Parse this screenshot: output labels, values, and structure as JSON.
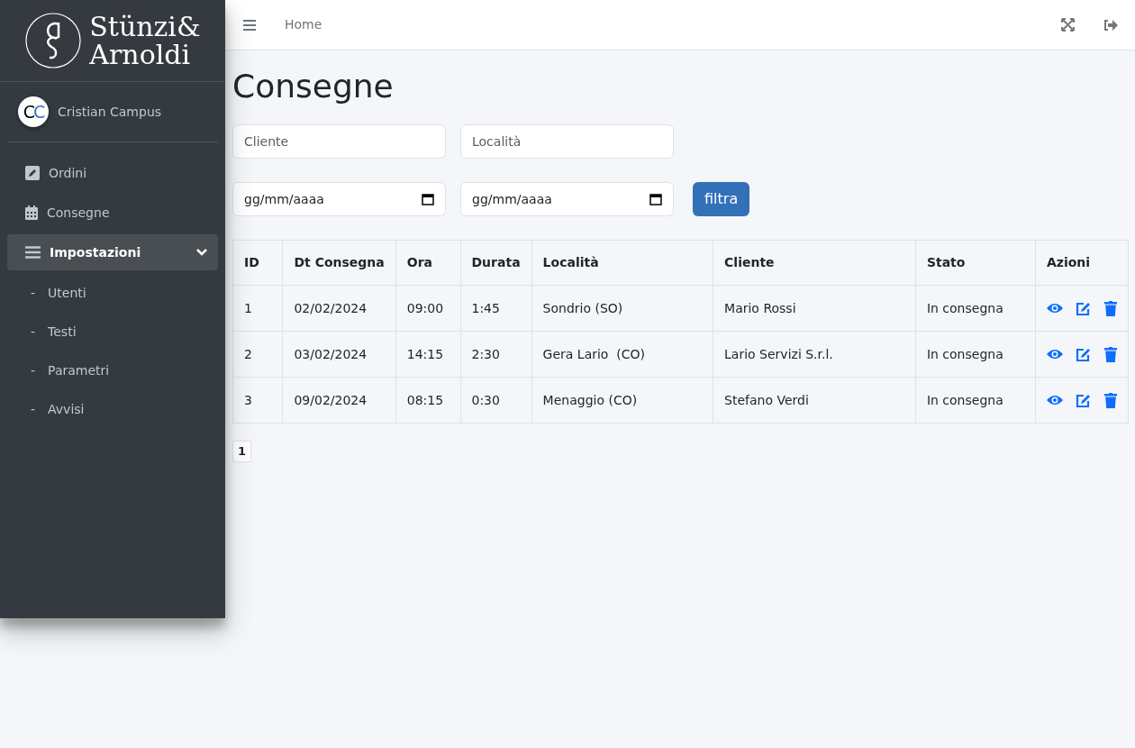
{
  "brand": {
    "lines": [
      "Stünzi&",
      "Arnoldi"
    ]
  },
  "user": {
    "initials": [
      "C",
      "C"
    ],
    "name": "Cristian Campus"
  },
  "sidebar": {
    "items": [
      {
        "label": "Ordini",
        "kind": "edit",
        "selected": false
      },
      {
        "label": "Consegne",
        "kind": "calendar",
        "selected": false
      },
      {
        "label": "Impostazioni",
        "kind": "group",
        "selected": true,
        "expanded": true,
        "children": [
          {
            "bullet": "-",
            "label": "Utenti"
          },
          {
            "bullet": "-",
            "label": "Testi"
          },
          {
            "bullet": "-",
            "label": "Parametri"
          },
          {
            "bullet": "-",
            "label": "Avvisi"
          }
        ]
      }
    ]
  },
  "topbar": {
    "breadcrumb": "Home"
  },
  "page_title": "Consegne",
  "filters": {
    "cliente": {
      "placeholder": "Cliente"
    },
    "localita": {
      "placeholder": "Località"
    },
    "date_from": {
      "value": "gg/mm/aaaa"
    },
    "date_to": {
      "value": "gg/mm/aaaa"
    },
    "button": "filtra"
  },
  "table": {
    "columns": [
      "ID",
      "Dt Consegna",
      "Ora",
      "Durata",
      "Località",
      "Cliente",
      "Stato",
      "Azioni"
    ],
    "rows": [
      {
        "cells": [
          "1",
          "02/02/2024",
          "09:00",
          "1:45",
          "Sondrio (SO)",
          "Mario Rossi",
          "In consegna"
        ]
      },
      {
        "cells": [
          "2",
          "03/02/2024",
          "14:15",
          "2:30",
          "Gera Lario  (CO)",
          "Lario Servizi S.r.l.",
          "In consegna"
        ]
      },
      {
        "cells": [
          "3",
          "09/02/2024",
          "08:15",
          "0:30",
          "Menaggio (CO)",
          "Stefano Verdi",
          "In consegna"
        ]
      }
    ]
  },
  "pagination": {
    "pages": [
      {
        "label": "1",
        "selected": true
      }
    ]
  }
}
